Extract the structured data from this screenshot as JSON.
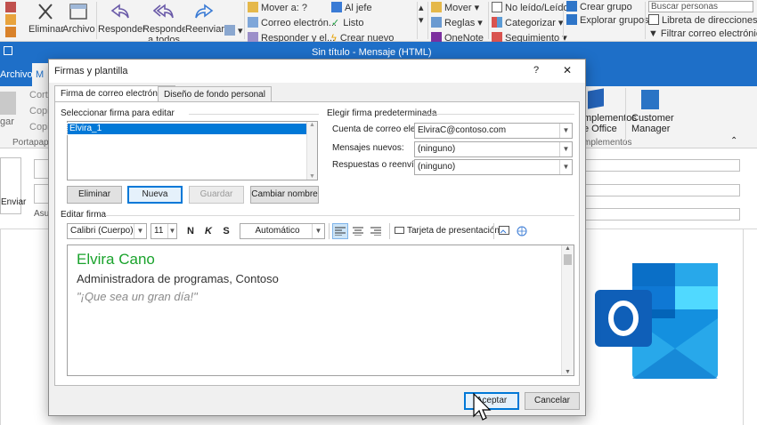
{
  "background_ribbon": {
    "delete_label": "Eliminar",
    "archive_label": "Archivo",
    "reply_label": "Responder",
    "reply_all_label": "Responder a todos",
    "forward_label": "Reenviar",
    "move_to_label": "Mover a: ?",
    "email_label": "Correo electrón...",
    "reply_delete_label": "Responder y el...",
    "to_boss_label": "Al jefe",
    "done_label": "Listo",
    "create_new_label": "Crear nuevo",
    "move_label": "Mover",
    "rules_label": "Reglas",
    "onenote_label": "OneNote",
    "unread_label": "No leído/Leído",
    "categorize_label": "Categorizar",
    "followup_label": "Seguimiento",
    "create_group_label": "Crear grupo",
    "explore_groups_label": "Explorar grupos",
    "search_people_placeholder": "Buscar personas",
    "address_book_label": "Libreta de direcciones",
    "filter_email_label": "Filtrar correo electrónico"
  },
  "message_window": {
    "title": "Sin título  -  Mensaje (HTML)",
    "tab_file": "Archivo",
    "tab_m": "M",
    "cut_label": "Corta",
    "copy_label": "Copi",
    "copy_format_label": "Copi",
    "paste_label": "gar",
    "clipboard_group": "Portapape",
    "send_label": "Enviar",
    "subject_prefix": "Asu",
    "office_addins_label": "mplementos\ne Office",
    "addins_group": "mplementos",
    "customer_manager_label": "Customer\nManager"
  },
  "dialog": {
    "title": "Firmas y plantilla",
    "help_label": "?",
    "close_label": "✕",
    "tabs": [
      {
        "label": "Firma de correo electrónico"
      },
      {
        "label": "Diseño de fondo personal"
      }
    ],
    "select_signature_label": "Seleccionar firma para editar",
    "signatures": [
      "Elvira_1"
    ],
    "btn_delete": "Eliminar",
    "btn_new": "Nueva",
    "btn_save": "Guardar",
    "btn_rename": "Cambiar nombre",
    "default_signature_label": "Elegir firma predeterminada",
    "account_label": "Cuenta de correo electrónico:",
    "account_value": "ElviraC@contoso.com",
    "new_messages_label": "Mensajes nuevos:",
    "new_messages_value": "(ninguno)",
    "replies_label": "Respuestas o reenvíos:",
    "replies_value": "(ninguno)",
    "edit_signature_label": "Editar firma",
    "font_value": "Calibri (Cuerpo)",
    "size_value": "11",
    "bold_label": "N",
    "italic_label": "K",
    "underline_label": "S",
    "color_value": "Automático",
    "business_card_label": "Tarjeta de presentación",
    "signature_name": "Elvira Cano",
    "signature_title": "Administradora de programas, Contoso",
    "signature_quote": "\"¡Que sea un gran día!\"",
    "btn_ok": "Aceptar",
    "btn_cancel": "Cancelar"
  },
  "colors": {
    "outlook_blue": "#1e6fc8",
    "signature_green": "#1aa32c",
    "focus_blue": "#0078d7"
  }
}
